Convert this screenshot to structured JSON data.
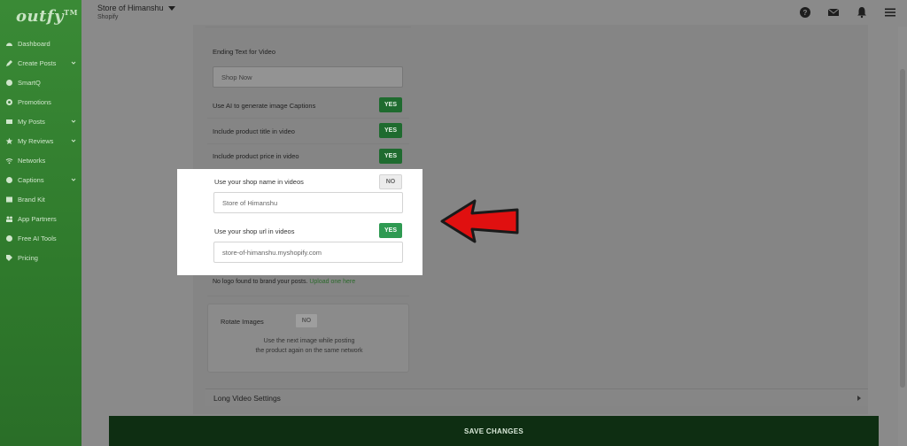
{
  "sidebar": {
    "logo": "outfy",
    "logo_tm": "TM",
    "items": [
      {
        "label": "Dashboard",
        "icon": "dashboard-icon",
        "chevron": false
      },
      {
        "label": "Create Posts",
        "icon": "pencil-icon",
        "chevron": true
      },
      {
        "label": "SmartQ",
        "icon": "smartq-icon",
        "chevron": false
      },
      {
        "label": "Promotions",
        "icon": "promotions-icon",
        "chevron": false
      },
      {
        "label": "My Posts",
        "icon": "posts-icon",
        "chevron": true
      },
      {
        "label": "My Reviews",
        "icon": "star-icon",
        "chevron": true
      },
      {
        "label": "Networks",
        "icon": "wifi-icon",
        "chevron": false
      },
      {
        "label": "Captions",
        "icon": "captions-icon",
        "chevron": true
      },
      {
        "label": "Brand Kit",
        "icon": "brand-kit-icon",
        "chevron": false
      },
      {
        "label": "App Partners",
        "icon": "partners-icon",
        "chevron": false
      },
      {
        "label": "Free AI Tools",
        "icon": "ai-tools-icon",
        "chevron": false
      },
      {
        "label": "Pricing",
        "icon": "tag-icon",
        "chevron": false
      }
    ]
  },
  "topbar": {
    "store_name": "Store of Himanshu",
    "platform": "Shopify",
    "icons": [
      "help-icon",
      "mail-icon",
      "bell-icon",
      "menu-icon"
    ]
  },
  "form": {
    "ending_text_label": "Ending Text for Video",
    "ending_text_value": "Shop Now",
    "ai_captions_label": "Use AI to generate image Captions",
    "ai_captions_toggle": "YES",
    "product_title_label": "Include product title in video",
    "product_title_toggle": "YES",
    "product_price_label": "Include product price in video",
    "product_price_toggle": "YES",
    "shop_name_label": "Use your shop name in videos",
    "shop_name_toggle": "NO",
    "shop_name_value": "Store of  Himanshu",
    "shop_url_label": "Use your shop url in videos",
    "shop_url_toggle": "YES",
    "shop_url_value": "store-of-himanshu.myshopify.com",
    "no_logo_text": "No logo found to brand your posts.",
    "upload_link": "Upload one here",
    "rotate_label": "Rotate Images",
    "rotate_toggle": "NO",
    "rotate_help_1": "Use the next image while posting",
    "rotate_help_2": "the product again on the same network"
  },
  "long_video": {
    "label": "Long Video Settings"
  },
  "save": {
    "label": "SAVE CHANGES"
  },
  "colors": {
    "sidebar_green": "#2f7a2c",
    "toggle_yes": "#1f6b2f",
    "card_yes": "#2f9a52",
    "save_bar": "#0e2e12",
    "arrow_red": "#e01010"
  }
}
